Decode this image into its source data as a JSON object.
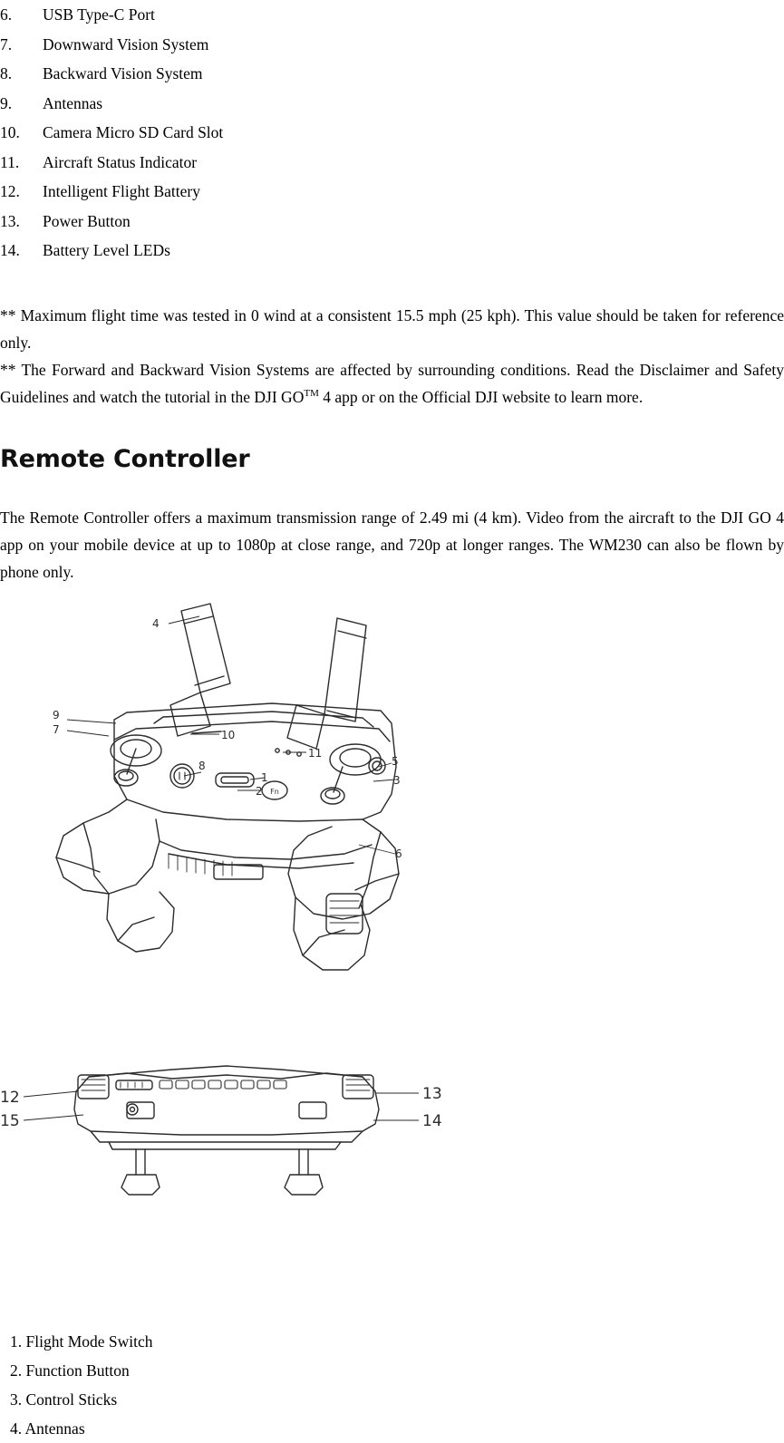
{
  "parts_list": [
    {
      "num": "6.",
      "label": "USB Type-C Port"
    },
    {
      "num": "7.",
      "label": "Downward Vision System"
    },
    {
      "num": "8.",
      "label": "Backward Vision System"
    },
    {
      "num": "9.",
      "label": "Antennas"
    },
    {
      "num": "10.",
      "label": "Camera Micro SD Card Slot"
    },
    {
      "num": "11.",
      "label": "Aircraft Status Indicator"
    },
    {
      "num": "12.",
      "label": "Intelligent Flight Battery"
    },
    {
      "num": "13.",
      "label": "Power Button"
    },
    {
      "num": "14.",
      "label": "Battery Level LEDs"
    }
  ],
  "footnotes": {
    "note1": "** Maximum flight time was tested in 0 wind at a consistent 15.5 mph (25 kph). This value should be taken for reference only.",
    "note2_part1": "** The Forward and Backward Vision Systems are affected by surrounding conditions. Read the Disclaimer and Safety Guidelines and watch the tutorial in the DJI GO",
    "note2_sup": "TM",
    "note2_part2": " 4 app or on the Official DJI website to learn more."
  },
  "section": {
    "title": "Remote Controller",
    "body": "The Remote Controller offers a maximum transmission range of 2.49 mi (4 km). Video from the aircraft to the DJI GO 4 app on your mobile device at up to 1080p at close range, and 720p at longer ranges. The WM230 can also be flown by phone only."
  },
  "figure_top": {
    "callouts": [
      "4",
      "9",
      "7",
      "10",
      "8",
      "11",
      "1",
      "2",
      "5",
      "3",
      "6"
    ]
  },
  "figure_bottom": {
    "callouts": [
      "12",
      "15",
      "13",
      "14"
    ]
  },
  "legend": [
    "1. Flight Mode Switch",
    "2. Function Button",
    "3. Control Sticks",
    "4. Antennas"
  ]
}
